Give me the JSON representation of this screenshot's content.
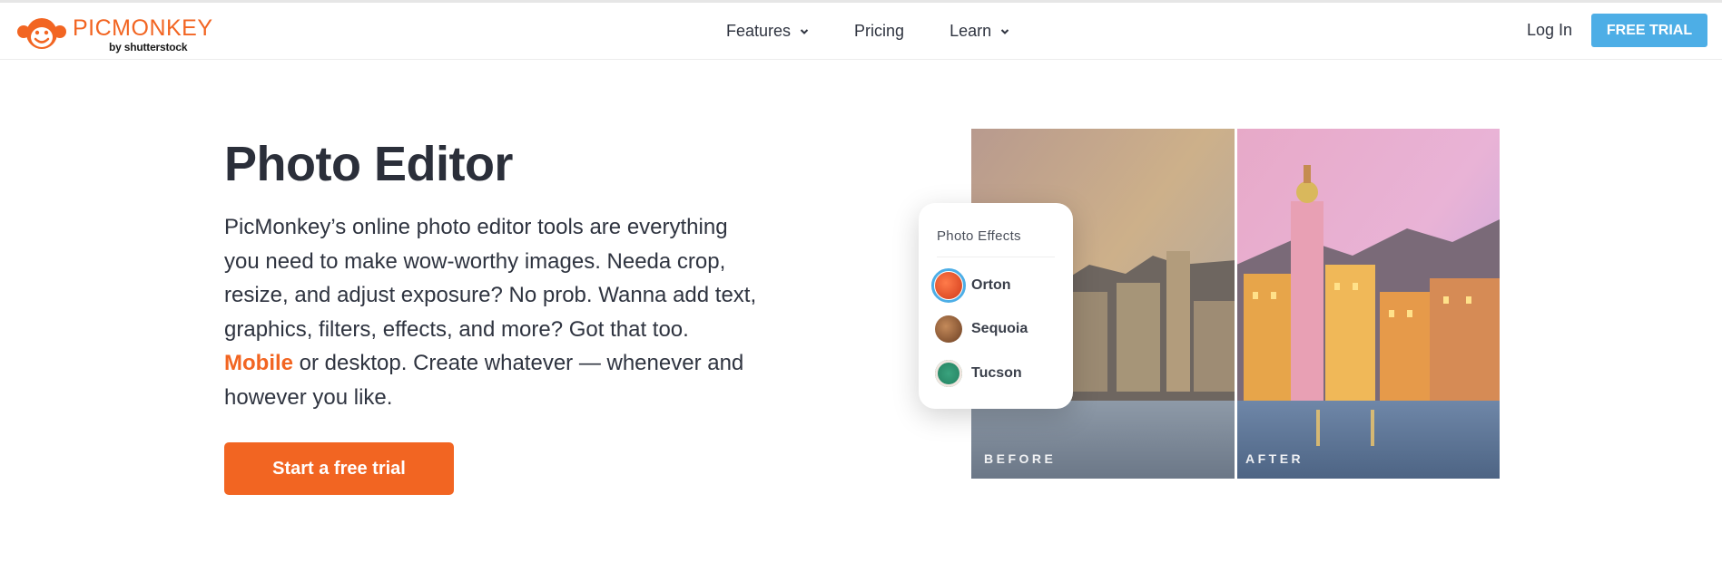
{
  "header": {
    "brand": "PICMONKEY",
    "brand_sub": "by shutterstock",
    "nav": [
      {
        "label": "Features",
        "dropdown": true
      },
      {
        "label": "Pricing",
        "dropdown": false
      },
      {
        "label": "Learn",
        "dropdown": true
      }
    ],
    "login_label": "Log In",
    "trial_label": "FREE TRIAL"
  },
  "hero": {
    "title": "Photo Editor",
    "desc_before": "PicMonkey’s online photo editor tools are everything you need to make wow-worthy images. Needa crop, resize, and adjust exposure? No prob. Wanna add text, graphics, filters, effects, and more? Got that too. ",
    "desc_link": "Mobile",
    "desc_after": " or desktop. Create whatever — whenever and however you like.",
    "cta_label": "Start a free trial"
  },
  "compare": {
    "before_label": "BEFORE",
    "after_label": "AFTER"
  },
  "effects": {
    "title": "Photo Effects",
    "items": [
      {
        "label": "Orton",
        "selected": true
      },
      {
        "label": "Sequoia",
        "selected": false
      },
      {
        "label": "Tucson",
        "selected": false
      }
    ]
  },
  "colors": {
    "brand_orange": "#f26522",
    "trial_blue": "#4daee6",
    "text_dark": "#2b2f3a"
  }
}
